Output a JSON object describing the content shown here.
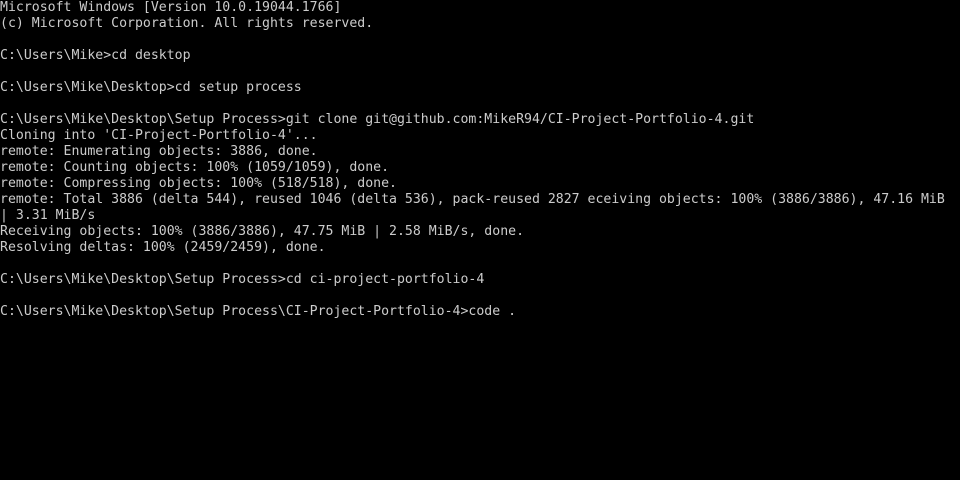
{
  "terminal": {
    "text_color": "#cccccc",
    "background_color": "#000000",
    "lines": [
      "Microsoft Windows [Version 10.0.19044.1766]",
      "(c) Microsoft Corporation. All rights reserved.",
      "",
      "C:\\Users\\Mike>cd desktop",
      "",
      "C:\\Users\\Mike\\Desktop>cd setup process",
      "",
      "C:\\Users\\Mike\\Desktop\\Setup Process>git clone git@github.com:MikeR94/CI-Project-Portfolio-4.git",
      "Cloning into 'CI-Project-Portfolio-4'...",
      "remote: Enumerating objects: 3886, done.",
      "remote: Counting objects: 100% (1059/1059), done.",
      "remote: Compressing objects: 100% (518/518), done.",
      "remote: Total 3886 (delta 544), reused 1046 (delta 536), pack-reused 2827 eceiving objects: 100% (3886/3886), 47.16 MiB",
      "| 3.31 MiB/s",
      "Receiving objects: 100% (3886/3886), 47.75 MiB | 2.58 MiB/s, done.",
      "Resolving deltas: 100% (2459/2459), done.",
      "",
      "C:\\Users\\Mike\\Desktop\\Setup Process>cd ci-project-portfolio-4",
      "",
      "C:\\Users\\Mike\\Desktop\\Setup Process\\CI-Project-Portfolio-4>code ."
    ]
  }
}
